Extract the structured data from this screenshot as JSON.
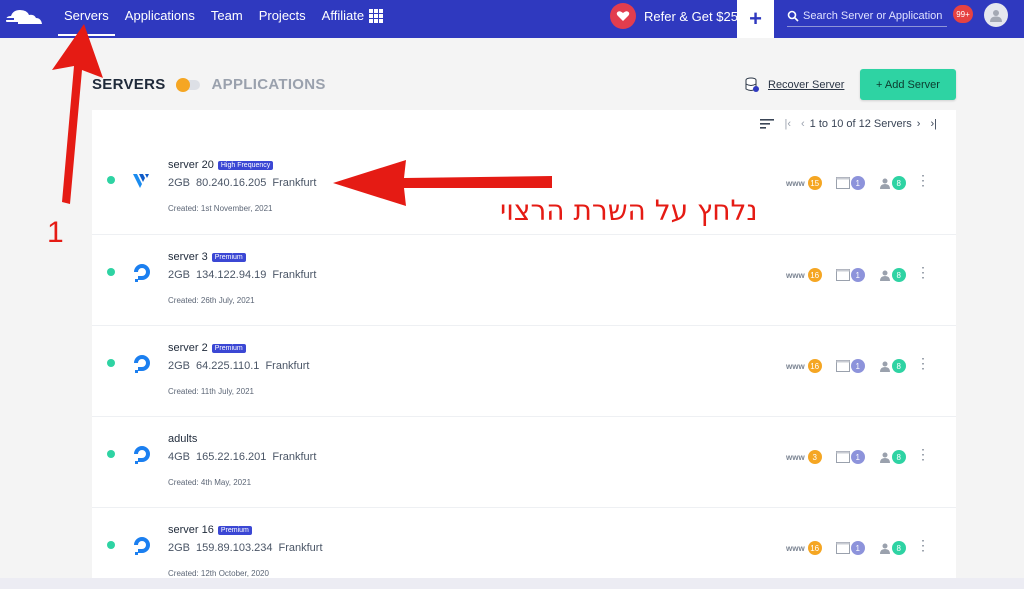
{
  "nav": {
    "links": [
      "Servers",
      "Applications",
      "Team",
      "Projects",
      "Affiliate"
    ],
    "refer_label": "Refer & Get $25",
    "search_placeholder": "Search Server or Application",
    "notifications": "99+"
  },
  "header": {
    "servers_label": "SERVERS",
    "applications_label": "APPLICATIONS",
    "recover_label": "Recover Server",
    "add_label": "+ Add Server"
  },
  "pager": {
    "text": "1 to 10 of 12 Servers"
  },
  "servers": [
    {
      "name": "server 20",
      "tag": "High Frequency",
      "size": "2GB",
      "ip": "80.240.16.205",
      "location": "Frankfurt",
      "created": "Created: 1st November, 2021",
      "www": "15",
      "apps": "1",
      "users": "8",
      "provider": "vultr-icon"
    },
    {
      "name": "server 3",
      "tag": "Premium",
      "size": "2GB",
      "ip": "134.122.94.19",
      "location": "Frankfurt",
      "created": "Created: 26th July, 2021",
      "www": "16",
      "apps": "1",
      "users": "8",
      "provider": "digitalocean-icon"
    },
    {
      "name": "server 2",
      "tag": "Premium",
      "size": "2GB",
      "ip": "64.225.110.1",
      "location": "Frankfurt",
      "created": "Created: 11th July, 2021",
      "www": "16",
      "apps": "1",
      "users": "8",
      "provider": "digitalocean-icon"
    },
    {
      "name": "adults",
      "tag": "",
      "size": "4GB",
      "ip": "165.22.16.201",
      "location": "Frankfurt",
      "created": "Created: 4th May, 2021",
      "www": "3",
      "apps": "1",
      "users": "8",
      "provider": "digitalocean-icon"
    },
    {
      "name": "server 16",
      "tag": "Premium",
      "size": "2GB",
      "ip": "159.89.103.234",
      "location": "Frankfurt",
      "created": "Created: 12th October, 2020",
      "www": "16",
      "apps": "1",
      "users": "8",
      "provider": "digitalocean-icon"
    }
  ],
  "stat_label": "www",
  "annotation": {
    "hebrew": "נלחץ על השרת הרצוי",
    "step": "1"
  },
  "colors": {
    "nav": "#2f39bf",
    "accent": "#2ed3a3",
    "annotation": "#e51b14"
  }
}
